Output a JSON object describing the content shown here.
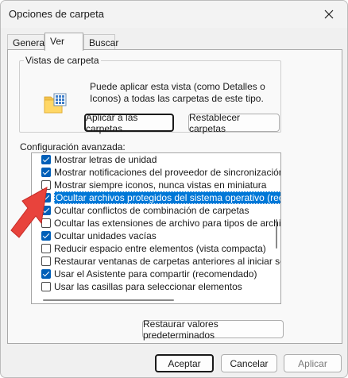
{
  "window": {
    "title": "Opciones de carpeta"
  },
  "tabs": [
    {
      "label": "General"
    },
    {
      "label": "Ver"
    },
    {
      "label": "Buscar"
    }
  ],
  "vistas": {
    "legend": "Vistas de carpeta",
    "description": "Puede aplicar esta vista (como Detalles o Iconos) a todas las carpetas de este tipo.",
    "apply_button": "Aplicar a las carpetas",
    "reset_button": "Restablecer carpetas"
  },
  "advanced": {
    "label": "Configuración avanzada:",
    "items": [
      {
        "label": "Mostrar letras de unidad",
        "checked": true
      },
      {
        "label": "Mostrar notificaciones del proveedor de sincronización",
        "checked": true
      },
      {
        "label": "Mostrar siempre iconos, nunca vistas en miniatura",
        "checked": false
      },
      {
        "label": "Ocultar archivos protegidos del sistema operativo (recome",
        "checked": true,
        "selected": true
      },
      {
        "label": "Ocultar conflictos de combinación de carpetas",
        "checked": true
      },
      {
        "label": "Ocultar las extensiones de archivo para tipos de archivo c",
        "checked": false
      },
      {
        "label": "Ocultar unidades vacías",
        "checked": true
      },
      {
        "label": "Reducir espacio entre elementos (vista compacta)",
        "checked": false
      },
      {
        "label": "Restaurar ventanas de carpetas anteriores al iniciar sesió",
        "checked": false
      },
      {
        "label": "Usar el Asistente para compartir (recomendado)",
        "checked": true
      },
      {
        "label": "Usar las casillas para seleccionar elementos",
        "checked": false
      }
    ],
    "restore_defaults_button": "Restaurar valores predeterminados"
  },
  "footer": {
    "accept_button": "Aceptar",
    "cancel_button": "Cancelar",
    "apply_button": "Aplicar"
  },
  "colors": {
    "accent": "#005fb8",
    "selection": "#0078d7",
    "annotation_arrow": "#e8433c"
  }
}
